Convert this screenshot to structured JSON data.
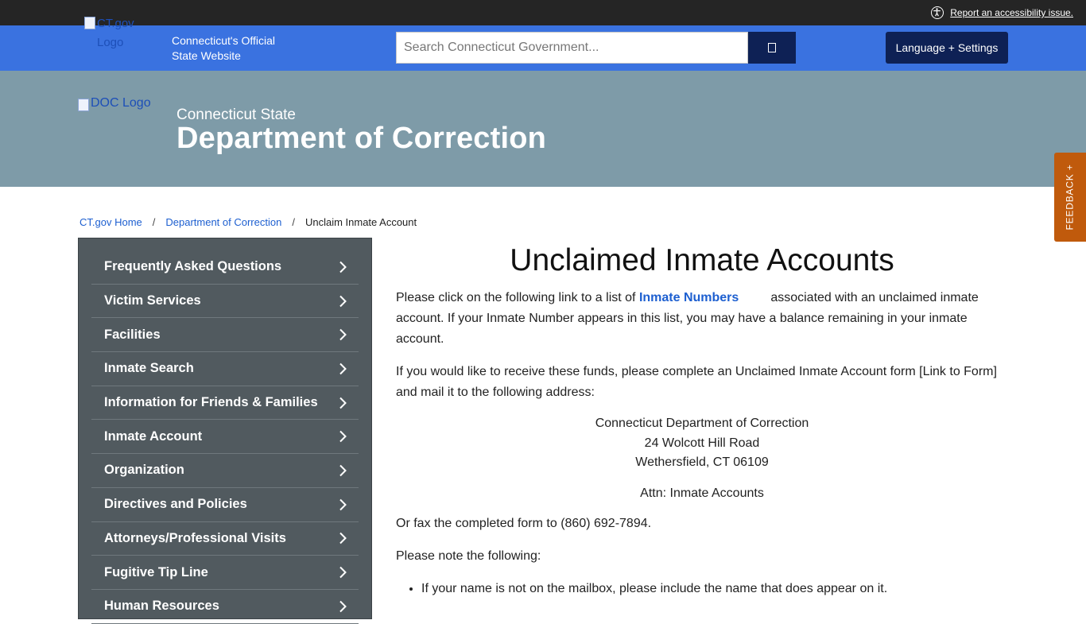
{
  "accessibility": {
    "link_text": "Report an accessibility issue."
  },
  "ctgov": {
    "logo_alt": "CT.gov Logo",
    "official_text": "Connecticut's Official State Website",
    "search_placeholder": "Search Connecticut Government...",
    "language_button": "Language + Settings"
  },
  "agency": {
    "logo_alt": "DOC Logo",
    "subtitle": "Connecticut State",
    "title": "Department of Correction"
  },
  "feedback_tab": "FEEDBACK +",
  "breadcrumb": {
    "items": [
      "CT.gov Home",
      "Department of Correction"
    ],
    "current": "Unclaim Inmate Account",
    "separator": "/"
  },
  "sidebar": {
    "items": [
      "Frequently Asked Questions",
      "Victim Services",
      "Facilities",
      "Inmate Search",
      "Information for Friends & Families",
      "Inmate Account",
      "Organization",
      "Directives and Policies",
      "Attorneys/Professional Visits",
      "Fugitive Tip Line",
      "Human Resources"
    ]
  },
  "content": {
    "title": "Unclaimed Inmate Accounts",
    "p1_before": "Please click on the following link to a list of ",
    "p1_link": "Inmate Numbers",
    "p1_after": "associated with an unclaimed inmate account. If your Inmate Number appears in this list, you may have a balance remaining in your inmate account.",
    "p2": "If you would like to receive these funds, please complete an Unclaimed Inmate Account form [Link to Form] and mail it to the following address:",
    "address": [
      "Connecticut Department of Correction",
      "24 Wolcott Hill Road",
      "Wethersfield, CT 06109"
    ],
    "attn": "Attn: Inmate Accounts",
    "p3": "Or fax the completed form to (860) 692-7894.",
    "p4": "Please note the following:",
    "bullets": [
      "If your name is not on the mailbox, please include the name that does appear on it."
    ]
  },
  "colors": {
    "top_bar": "#252525",
    "ctgov_bar": "#3a72e0",
    "navy_button": "#0e2155",
    "hero": "#7e9ba8",
    "sidebar": "#515a5f",
    "feedback": "#c05a0c",
    "link": "#1d5fd0"
  }
}
